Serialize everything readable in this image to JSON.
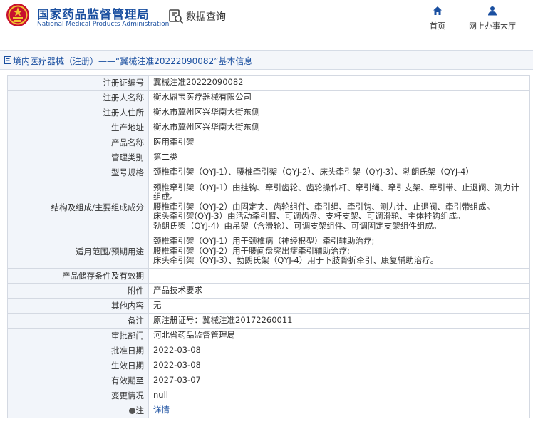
{
  "header": {
    "logo_cn": "国家药品监督管理局",
    "logo_en": "National Medical Products Administration",
    "query_label": "数据查询",
    "nav": [
      {
        "label": "首页",
        "icon": "home-icon"
      },
      {
        "label": "网上办事大厅",
        "icon": "user-icon"
      }
    ]
  },
  "breadcrumb": {
    "text": "境内医疗器械（注册）——“冀械注准20222090082”基本信息"
  },
  "colors": {
    "brand_blue": "#1a4fa0",
    "label_bg": "#f2f5fa",
    "border": "#d4d9e2"
  },
  "rows": [
    {
      "label": "注册证编号",
      "value": "冀械注准20222090082"
    },
    {
      "label": "注册人名称",
      "value": "衡水鼎宝医疗器械有限公司"
    },
    {
      "label": "注册人住所",
      "value": "衡水市冀州区兴华南大街东侧"
    },
    {
      "label": "生产地址",
      "value": "衡水市冀州区兴华南大街东侧"
    },
    {
      "label": "产品名称",
      "value": "医用牵引架"
    },
    {
      "label": "管理类别",
      "value": "第二类"
    },
    {
      "label": "型号规格",
      "value": "颈椎牵引架（QYJ-1）、腰椎牵引架（QYJ-2）、床头牵引架（QYJ-3）、勃朗氏架（QYJ-4）"
    },
    {
      "label": "结构及组成/主要组成成分",
      "lines": [
        "颈椎牵引架（QYJ-1）由挂钩、牵引齿轮、齿轮操作杆、牵引绳、牵引支架、牵引带、止退阀、测力计组成。",
        "腰椎牵引架（QYJ-2）由固定夹、齿轮组件、牵引绳、牵引钩、测力计、止退阀、牵引带组成。",
        "床头牵引架(QYJ-3）由活动牵引臂、可调齿盘、支杆支架、可调滑轮、主体挂钩组成。",
        "勃朗氏架（QYJ-4）由吊架（含滑轮）、可调支架组件、可调固定支架组件组成。"
      ]
    },
    {
      "label": "适用范围/预期用途",
      "lines": [
        "颈椎牵引架（QYJ-1）用于颈椎病（神经根型）牵引辅助治疗;",
        "腰椎牵引架（QYJ-2）用于腰间盘突出症牵引辅助治疗;",
        "床头牵引架（QYJ-3）、勃朗氏架（QYJ-4）用于下肢骨折牵引、康复辅助治疗。"
      ]
    },
    {
      "label": "产品储存条件及有效期",
      "value": ""
    },
    {
      "label": "附件",
      "value": "产品技术要求"
    },
    {
      "label": "其他内容",
      "value": "无"
    },
    {
      "label": "备注",
      "value": "原注册证号：冀械注准20172260011"
    },
    {
      "label": "审批部门",
      "value": "河北省药品监督管理局"
    },
    {
      "label": "批准日期",
      "value": "2022-03-08"
    },
    {
      "label": "生效日期",
      "value": "2022-03-08"
    },
    {
      "label": "有效期至",
      "value": "2027-03-07"
    },
    {
      "label": "变更情况",
      "value": "null"
    },
    {
      "label": "注",
      "value": "详情"
    }
  ]
}
